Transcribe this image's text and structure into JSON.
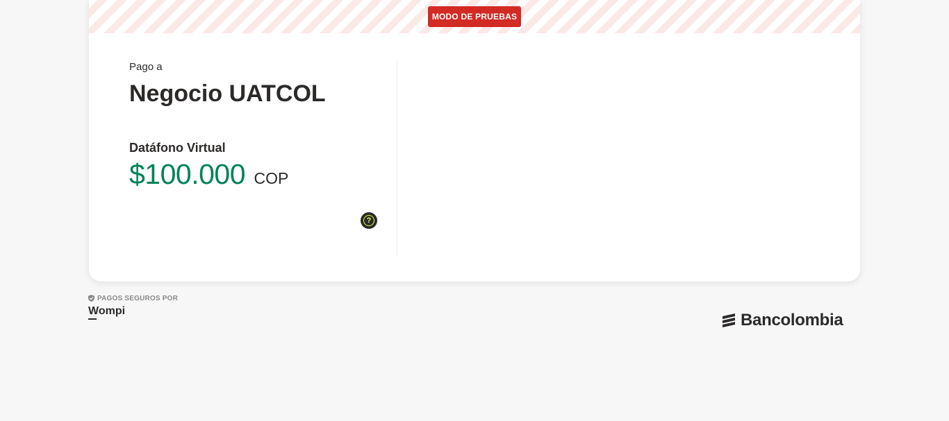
{
  "test_mode": {
    "label": "MODO DE PRUEBAS",
    "color": "#d22a25"
  },
  "payment": {
    "pay_to_label": "Pago a",
    "merchant_name": "Negocio UATCOL",
    "product_name": "Datáfono Virtual",
    "amount": "$100.000",
    "currency": "COP",
    "amount_color": "#00825a",
    "help_icon": "question-circle-icon",
    "help_label": "?"
  },
  "footer": {
    "secure_label": "PAGOS SEGUROS POR",
    "secure_icon": "shield-check-icon",
    "wompi_logo_text": "Wompi",
    "bank_logo_text": "Bancolombia",
    "bank_logo_icon": "bancolombia-stripes-icon"
  }
}
